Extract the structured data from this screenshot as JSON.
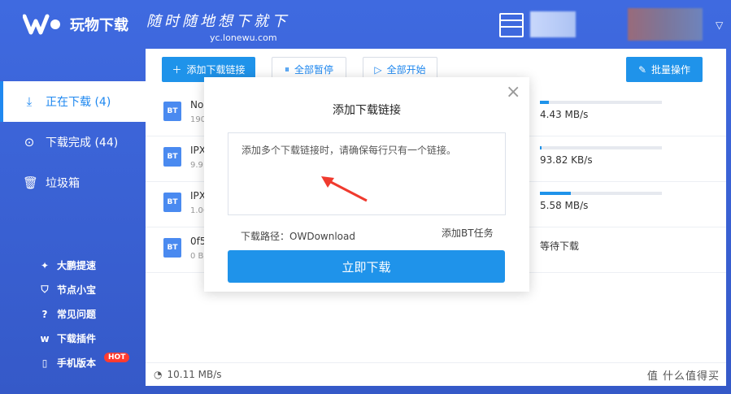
{
  "app": {
    "name": "玩物下载",
    "slogan": "随时随地想下就下",
    "url": "yc.lonewu.com",
    "menu_caret": "▽"
  },
  "sidebar": {
    "items": [
      {
        "label": "正在下载 (4)",
        "icon": "download-icon"
      },
      {
        "label": "下载完成 (44)",
        "icon": "check-circle-icon"
      },
      {
        "label": "垃圾箱",
        "icon": "trash-icon"
      }
    ],
    "links": [
      {
        "label": "大鹏提速",
        "icon": "wing-icon"
      },
      {
        "label": "节点小宝",
        "icon": "shield-icon"
      },
      {
        "label": "常见问题",
        "icon": "question-icon"
      },
      {
        "label": "下载插件",
        "icon": "logo-icon"
      },
      {
        "label": "手机版本",
        "icon": "phone-icon",
        "badge": "HOT"
      }
    ]
  },
  "toolbar": {
    "add_link": "添加下载链接",
    "pause_all": "全部暂停",
    "start_all": "全部开始",
    "batch": "批量操作"
  },
  "downloads": [
    {
      "type": "BT",
      "name": "Nor",
      "size": "190",
      "speed": "4.43 MB/s",
      "progress": 0.07
    },
    {
      "type": "BT",
      "name": "IPX",
      "size": "9.9:",
      "speed": "93.82 KB/s",
      "progress": 0.01
    },
    {
      "type": "BT",
      "name": "IPX",
      "size": "1.06",
      "speed": "5.58 MB/s",
      "progress": 0.25
    },
    {
      "type": "BT",
      "name": "0f5",
      "size": "0 B",
      "speed": "等待下载",
      "progress": 0
    }
  ],
  "status": {
    "total_speed": "10.11 MB/s",
    "watermark": "值 什么值得买"
  },
  "modal": {
    "title": "添加下载链接",
    "close": "×",
    "placeholder": "添加多个下载链接时，请确保每行只有一个链接。",
    "path_label": "下载路径：",
    "path_value": "OWDownload",
    "bt_task": "添加BT任务",
    "submit": "立即下载"
  }
}
